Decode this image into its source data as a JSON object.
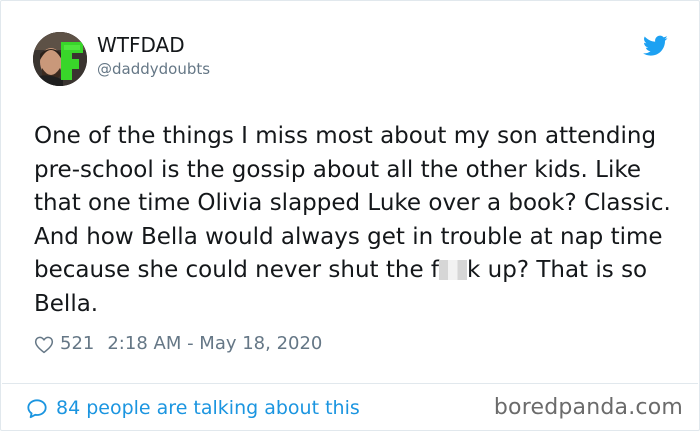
{
  "author": {
    "name": "WTFDAD",
    "handle": "@daddydoubts"
  },
  "tweet": {
    "text_before_censor": "One of the things I miss most about my son attending pre-school is the gossip about all the other kids. Like that one time Olivia slapped Luke over a book? Classic. And how Bella would always get in trouble at nap time because she could never shut the f",
    "text_after_censor": "k up? That is so Bella."
  },
  "meta": {
    "likes": "521",
    "timestamp": "2:18 AM - May 18, 2020"
  },
  "footer": {
    "discussion": "84 people are talking about this",
    "watermark": "boredpanda.com"
  },
  "icons": {
    "avatar": "avatar-photo-icon",
    "twitter": "twitter-bird-icon",
    "heart": "heart-icon",
    "bubble": "speech-bubble-icon"
  },
  "colors": {
    "twitter_blue": "#1da1f2",
    "link_blue": "#1b95e0",
    "muted": "#657786",
    "text": "#14171a",
    "border": "#e1e8ed"
  }
}
